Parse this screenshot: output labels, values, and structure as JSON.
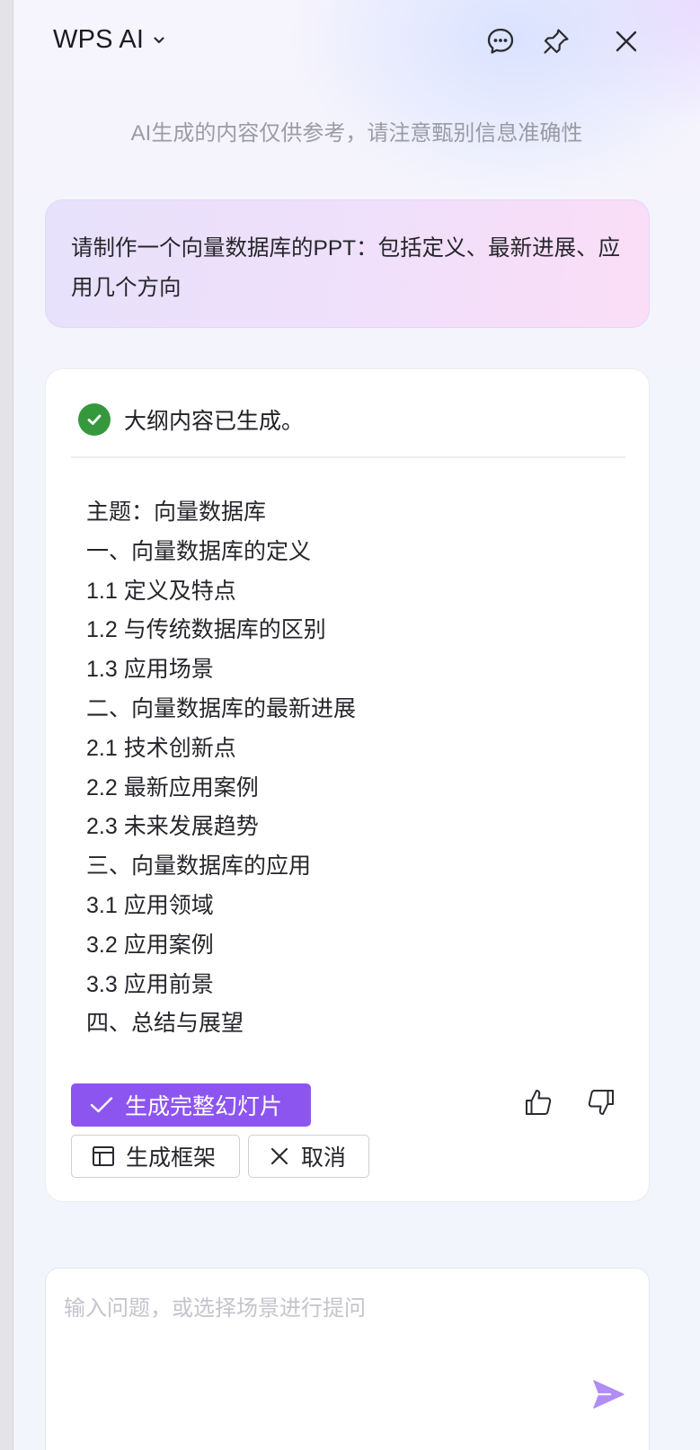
{
  "header": {
    "title": "WPS AI",
    "icons": [
      "chevron-down-icon",
      "chat-bubble-icon",
      "pin-icon",
      "close-icon"
    ]
  },
  "disclaimer": "AI生成的内容仅供参考，请注意甄别信息准确性",
  "user_prompt": "请制作一个向量数据库的PPT：包括定义、最新进展、应用几个方向",
  "response": {
    "status": "大纲内容已生成。",
    "outline": [
      "主题：向量数据库",
      "一、向量数据库的定义",
      "1.1 定义及特点",
      "1.2 与传统数据库的区别",
      "1.3 应用场景",
      "二、向量数据库的最新进展",
      "2.1 技术创新点",
      "2.2 最新应用案例",
      "2.3 未来发展趋势",
      "三、向量数据库的应用",
      "3.1 应用领域",
      "3.2 应用案例",
      "3.3 应用前景",
      "四、总结与展望"
    ],
    "primary_action": "生成完整幻灯片",
    "secondary_actions": {
      "frame": "生成框架",
      "cancel": "取消"
    }
  },
  "input": {
    "placeholder": "输入问题，或选择场景进行提问",
    "value": ""
  },
  "colors": {
    "accent": "#8d55f0",
    "success": "#35983d",
    "muted_text": "#9b9ba6"
  }
}
